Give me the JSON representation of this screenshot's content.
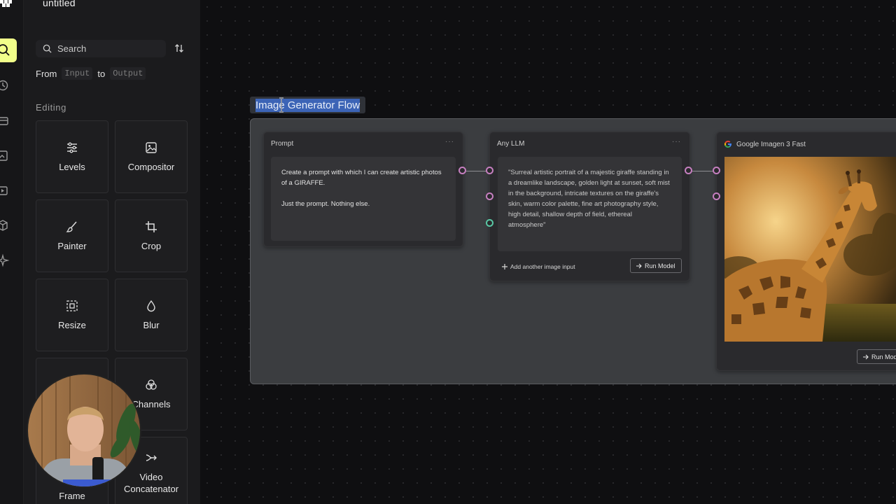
{
  "app": {
    "title": "untitled"
  },
  "search": {
    "placeholder": "Search"
  },
  "filter": {
    "from_label": "From",
    "from_chip": "Input",
    "to_label": "to",
    "to_chip": "Output"
  },
  "section": {
    "label": "Editing"
  },
  "tools": [
    {
      "label": "Levels",
      "icon": "sliders-icon"
    },
    {
      "label": "Compositor",
      "icon": "image-icon"
    },
    {
      "label": "Painter",
      "icon": "brush-icon"
    },
    {
      "label": "Crop",
      "icon": "crop-icon"
    },
    {
      "label": "Resize",
      "icon": "resize-icon"
    },
    {
      "label": "Blur",
      "icon": "droplet-icon"
    },
    {
      "label": "",
      "icon": ""
    },
    {
      "label": "Channels",
      "icon": "channels-icon"
    },
    {
      "label": "Frame",
      "icon": ""
    },
    {
      "label": "Video\nConcatenator",
      "icon": "video-merge-icon"
    }
  ],
  "canvas": {
    "group_title": "Image Generator Flow",
    "nodes": {
      "prompt": {
        "title": "Prompt",
        "text": "Create a prompt with which I can create artistic photos of a GIRAFFE.\n\nJust the prompt. Nothing else."
      },
      "llm": {
        "title": "Any LLM",
        "text": "\"Surreal artistic portrait of a majestic giraffe standing in a dreamlike landscape, golden light at sunset, soft mist in the background, intricate textures on the giraffe's skin, warm color palette, fine art photography style, high detail, shallow depth of field, ethereal atmosphere\"",
        "add_input_label": "Add another image input",
        "run_label": "Run Model"
      },
      "imagen": {
        "title": "Google Imagen 3 Fast",
        "run_label": "Run Mod"
      }
    }
  },
  "colors": {
    "accent": "#f1ff8a",
    "port": "#c67fc0",
    "port_green": "#59c7a4",
    "selection": "#3c64b6"
  }
}
